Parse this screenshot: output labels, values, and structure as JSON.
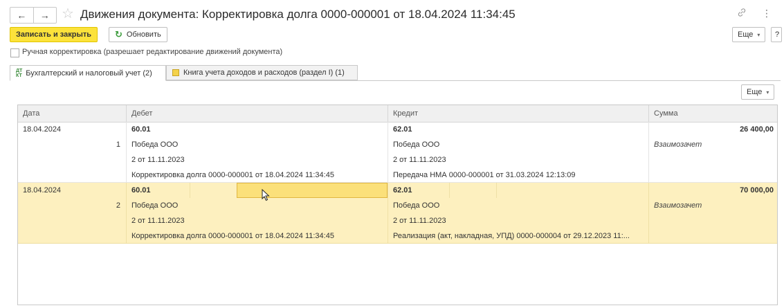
{
  "window": {
    "title": "Движения документа: Корректировка долга 0000-000001 от 18.04.2024 11:34:45",
    "back_icon": "←",
    "forward_icon": "→",
    "star_icon": "☆",
    "link_icon": "🔗",
    "more_icon": "⋮"
  },
  "toolbar": {
    "save_close": "Записать и закрыть",
    "refresh": "Обновить",
    "refresh_icon": "↻",
    "more": "Еще",
    "more_caret": "▾",
    "help": "?"
  },
  "manual_correction_label": "Ручная корректировка (разрешает редактирование движений документа)",
  "tabs": [
    {
      "label": "Бухгалтерский и налоговый учет (2)",
      "icon_top": "ДТ",
      "icon_bottom": "КТ",
      "active": true
    },
    {
      "label": "Книга учета доходов и расходов (раздел I) (1)",
      "active": false
    }
  ],
  "grid_more": "Еще",
  "table": {
    "columns": [
      "Дата",
      "Дебет",
      "Кредит",
      "Сумма"
    ],
    "records": [
      {
        "date": "18.04.2024",
        "number": "1",
        "debit": [
          "60.01",
          "Победа ООО",
          "2 от 11.11.2023",
          "Корректировка долга 0000-000001 от 18.04.2024 11:34:45"
        ],
        "credit": [
          "62.01",
          "Победа ООО",
          "2 от 11.11.2023",
          "Передача НМА 0000-000001 от 31.03.2024 12:13:09"
        ],
        "amount": "26 400,00",
        "operation": "Взаимозачет",
        "selected": false
      },
      {
        "date": "18.04.2024",
        "number": "2",
        "debit": [
          "60.01",
          "Победа ООО",
          "2 от 11.11.2023",
          "Корректировка долга 0000-000001 от 18.04.2024 11:34:45"
        ],
        "credit": [
          "62.01",
          "Победа ООО",
          "2 от 11.11.2023",
          "Реализация (акт, накладная, УПД) 0000-000004 от 29.12.2023 11:..."
        ],
        "amount": "70 000,00",
        "operation": "Взаимозачет",
        "selected": true
      }
    ]
  },
  "colors": {
    "primary_button": "#fce23b",
    "selected_row": "#fdf0bf",
    "focused_cell": "#fbe07a"
  }
}
